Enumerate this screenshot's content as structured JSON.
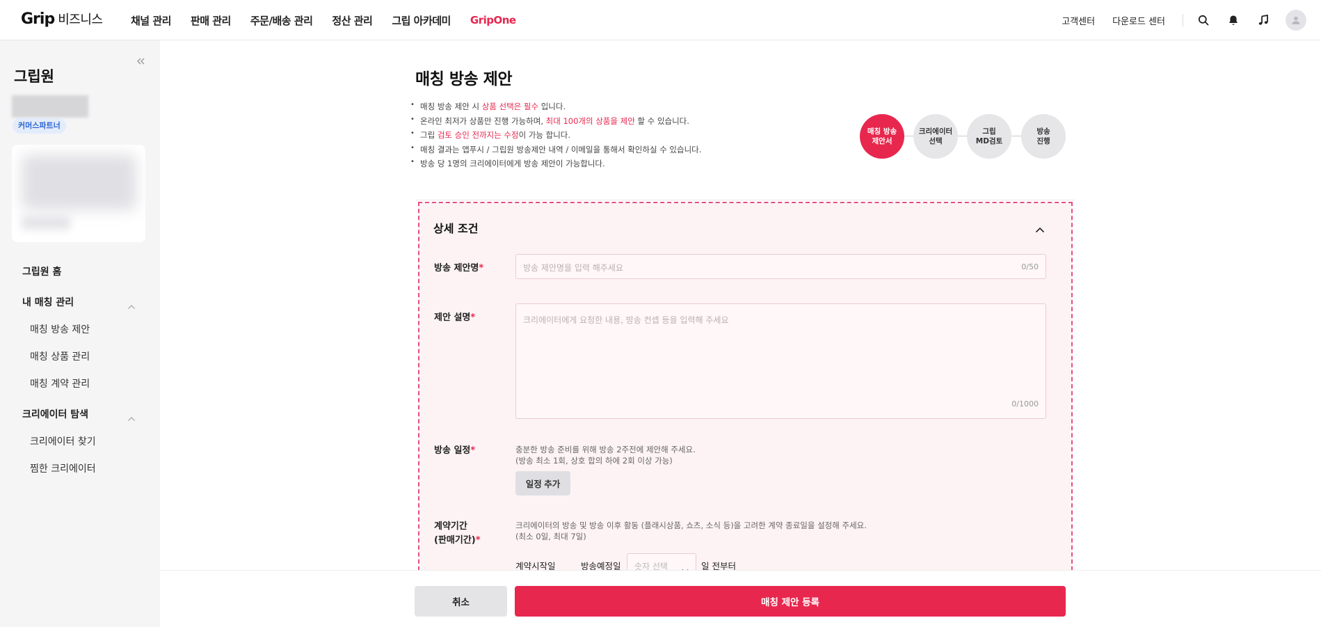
{
  "header": {
    "logo_brand": "Grip",
    "logo_suffix": "비즈니스",
    "nav": [
      "채널 관리",
      "판매 관리",
      "주문/배송 관리",
      "정산 관리",
      "그립 아카데미",
      "GripOne"
    ],
    "right_links": [
      "고객센터",
      "다운로드 센터"
    ],
    "icons": [
      "search-icon",
      "bell-icon",
      "music-note-icon",
      "user-avatar-icon"
    ]
  },
  "sidebar": {
    "title": "그립원",
    "badge": "커머스파트너",
    "home": "그립원 홈",
    "groups": [
      {
        "label": "내 매칭 관리",
        "items": [
          "매칭 방송 제안",
          "매칭 상품 관리",
          "매칭 계약 관리"
        ]
      },
      {
        "label": "크리에이터 탐색",
        "items": [
          "크리에이터 찾기",
          "찜한 크리에이터"
        ]
      }
    ]
  },
  "main": {
    "title": "매칭 방송 제안",
    "notes": [
      {
        "pre": "매칭 방송 제안 시 ",
        "hl": "상품 선택은 필수",
        "post": " 입니다."
      },
      {
        "pre": "온라인 최저가 상품만 진행 가능하며, ",
        "hl": "최대 100개의 상품을 제안",
        "post": " 할 수 있습니다."
      },
      {
        "pre": "그립 ",
        "hl": "검토 승인 전까지는 수정",
        "post": "이 가능 합니다."
      },
      {
        "pre": "매칭 결과는 앱푸시 / 그립원 방송제안 내역 / 이메일을 통해서 확인하실 수 있습니다.",
        "hl": "",
        "post": ""
      },
      {
        "pre": "방송 당 1명의 크리에이터에게 방송 제안이 가능합니다.",
        "hl": "",
        "post": ""
      }
    ],
    "steps": [
      {
        "line1": "매칭 방송",
        "line2": "제안서",
        "active": true
      },
      {
        "line1": "크리에이터",
        "line2": "선택",
        "active": false
      },
      {
        "line1": "그립",
        "line2": "MD검토",
        "active": false
      },
      {
        "line1": "방송",
        "line2": "진행",
        "active": false
      }
    ],
    "section_title": "상세 조건",
    "fields": {
      "title": {
        "label": "방송 제안명",
        "placeholder": "방송 제안명을 입력 해주세요",
        "count": "0/50"
      },
      "desc": {
        "label": "제안 설명",
        "placeholder": "크리에이터에게 요청한 내용, 방송 컨셉 등을 입력해 주세요",
        "count": "0/1000"
      },
      "schedule": {
        "label": "방송 일정",
        "help1": "충분한 방송 준비를 위해 방송 2주전에 제안해 주세요.",
        "help2": "(방송 최소 1회, 상호 합의 하에 2회 이상 가능)",
        "button": "일정 추가"
      },
      "contract": {
        "label1": "계약기간",
        "label2": "(판매기간)",
        "help1": "크리에이터의 방송 및 방송 이후 활동 (플래시상품, 쇼츠, 소식 등)을 고려한 계약 종료일을 설정해 주세요.",
        "help2": "(최소 0일, 최대 7일)",
        "start_label": "계약시작일",
        "date_label": "방송예정일",
        "select_placeholder": "숫자 선택",
        "suffix": "일 전부터"
      }
    }
  },
  "footer": {
    "cancel": "취소",
    "submit": "매칭 제안 등록"
  },
  "colors": {
    "accent": "#e8274e",
    "badge_bg": "#e3ecfb",
    "badge_text": "#2b64d1"
  }
}
